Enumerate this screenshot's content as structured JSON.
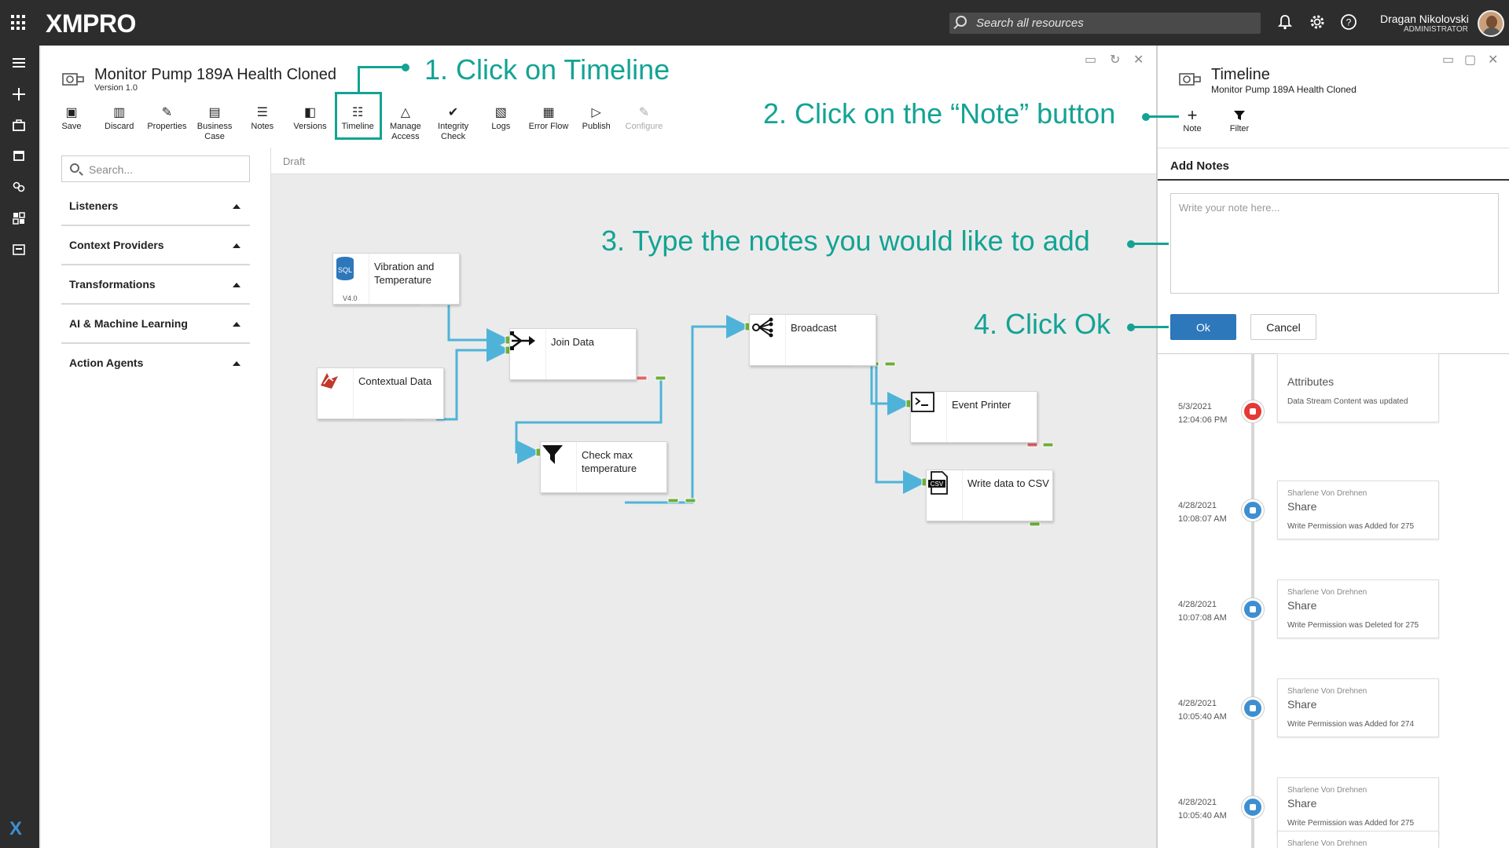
{
  "topbar": {
    "logo": "XMPRO",
    "search_placeholder": "Search all resources",
    "user_name": "Dragan Nikolovski",
    "user_role": "ADMINISTRATOR"
  },
  "page": {
    "title": "Monitor Pump 189A Health Cloned",
    "version": "Version 1.0"
  },
  "toolbar": [
    {
      "label": "Save",
      "icon": "save-icon"
    },
    {
      "label": "Discard",
      "icon": "trash-icon"
    },
    {
      "label": "Properties",
      "icon": "pencil-icon"
    },
    {
      "label": "Business Case",
      "icon": "briefcase-icon"
    },
    {
      "label": "Notes",
      "icon": "notes-icon"
    },
    {
      "label": "Versions",
      "icon": "versions-icon"
    },
    {
      "label": "Timeline",
      "icon": "timeline-icon"
    },
    {
      "label": "Manage Access",
      "icon": "access-icon"
    },
    {
      "label": "Integrity Check",
      "icon": "check-circle-icon"
    },
    {
      "label": "Logs",
      "icon": "logs-icon"
    },
    {
      "label": "Error Flow",
      "icon": "error-flow-icon"
    },
    {
      "label": "Publish",
      "icon": "play-icon"
    },
    {
      "label": "Configure",
      "icon": "pencil-icon",
      "disabled": true
    }
  ],
  "sidebar": {
    "search_placeholder": "Search...",
    "categories": [
      "Listeners",
      "Context Providers",
      "Transformations",
      "AI & Machine Learning",
      "Action Agents"
    ]
  },
  "canvas": {
    "status": "Draft",
    "nodes": {
      "vibration": {
        "label": "Vibration and Temperature",
        "version": "V4.0",
        "icon_text": "SQL"
      },
      "contextual": {
        "label": "Contextual Data"
      },
      "join": {
        "label": "Join Data"
      },
      "check": {
        "label": "Check max temperature"
      },
      "broadcast": {
        "label": "Broadcast"
      },
      "printer": {
        "label": "Event Printer"
      },
      "csv": {
        "label": "Write data to CSV",
        "icon_text": "CSV"
      }
    }
  },
  "timeline_panel": {
    "title": "Timeline",
    "subtitle": "Monitor Pump 189A Health Cloned",
    "note_label": "Note",
    "filter_label": "Filter",
    "add_notes_label": "Add Notes",
    "note_placeholder": "Write your note here...",
    "ok_label": "Ok",
    "cancel_label": "Cancel",
    "entries": [
      {
        "date": "5/3/2021",
        "time": "12:04:06 PM",
        "user": "",
        "action": "Attributes",
        "description": "Data Stream Content was updated",
        "color": "#e53935"
      },
      {
        "date": "4/28/2021",
        "time": "10:08:07 AM",
        "user": "Sharlene Von Drehnen",
        "action": "Share",
        "description": "Write Permission was Added for 275",
        "color": "#3d8fd1"
      },
      {
        "date": "4/28/2021",
        "time": "10:07:08 AM",
        "user": "Sharlene Von Drehnen",
        "action": "Share",
        "description": "Write Permission was Deleted for 275",
        "color": "#3d8fd1"
      },
      {
        "date": "4/28/2021",
        "time": "10:05:40 AM",
        "user": "Sharlene Von Drehnen",
        "action": "Share",
        "description": "Write Permission was Added for 274",
        "color": "#3d8fd1"
      },
      {
        "date": "4/28/2021",
        "time": "10:05:40 AM",
        "user": "Sharlene Von Drehnen",
        "action": "Share",
        "description": "Write Permission was Added for 275",
        "color": "#3d8fd1"
      },
      {
        "date": "",
        "time": "",
        "user": "Sharlene Von Drehnen",
        "action": "",
        "description": "",
        "color": "#3d8fd1"
      }
    ]
  },
  "annotations": {
    "step1": "1. Click on Timeline",
    "step2": "2. Click on the “Note” button",
    "step3": "3. Type the notes you would like to add",
    "step4": "4. Click Ok",
    "color": "#13a394"
  }
}
